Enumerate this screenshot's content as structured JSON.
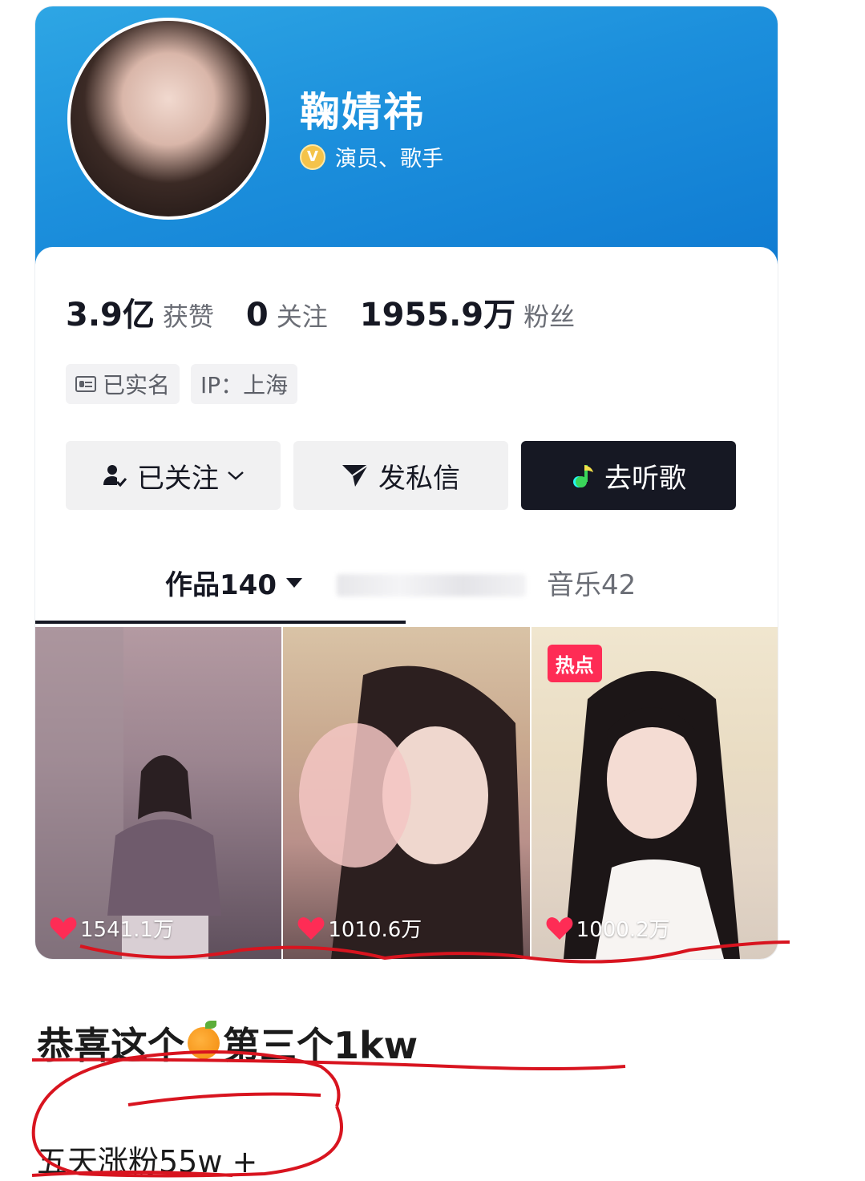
{
  "profile": {
    "name": "鞠婧祎",
    "verify_badge": "V",
    "verify_text": "演员、歌手"
  },
  "stats": [
    {
      "value": "3.9亿",
      "label": "获赞"
    },
    {
      "value": "0",
      "label": "关注"
    },
    {
      "value": "1955.9万",
      "label": "粉丝"
    }
  ],
  "tags": {
    "real_name": "已实名",
    "ip": "IP：上海"
  },
  "buttons": {
    "follow": "已关注",
    "message": "发私信",
    "listen": "去听歌"
  },
  "tabs": {
    "works": "作品140",
    "music": "音乐42"
  },
  "videos": [
    {
      "likes": "1541.1万",
      "badge": ""
    },
    {
      "likes": "1010.6万",
      "badge": ""
    },
    {
      "likes": "1000.2万",
      "badge": "热点"
    }
  ],
  "caption": {
    "part1": "恭喜这个",
    "part2": "第三个1kw",
    "sub": "五天涨粉55w +"
  },
  "colors": {
    "banner": "#1c8fdc",
    "accent_red": "#fe2c55",
    "dark_button": "#161823",
    "annotation": "#d8141f"
  }
}
